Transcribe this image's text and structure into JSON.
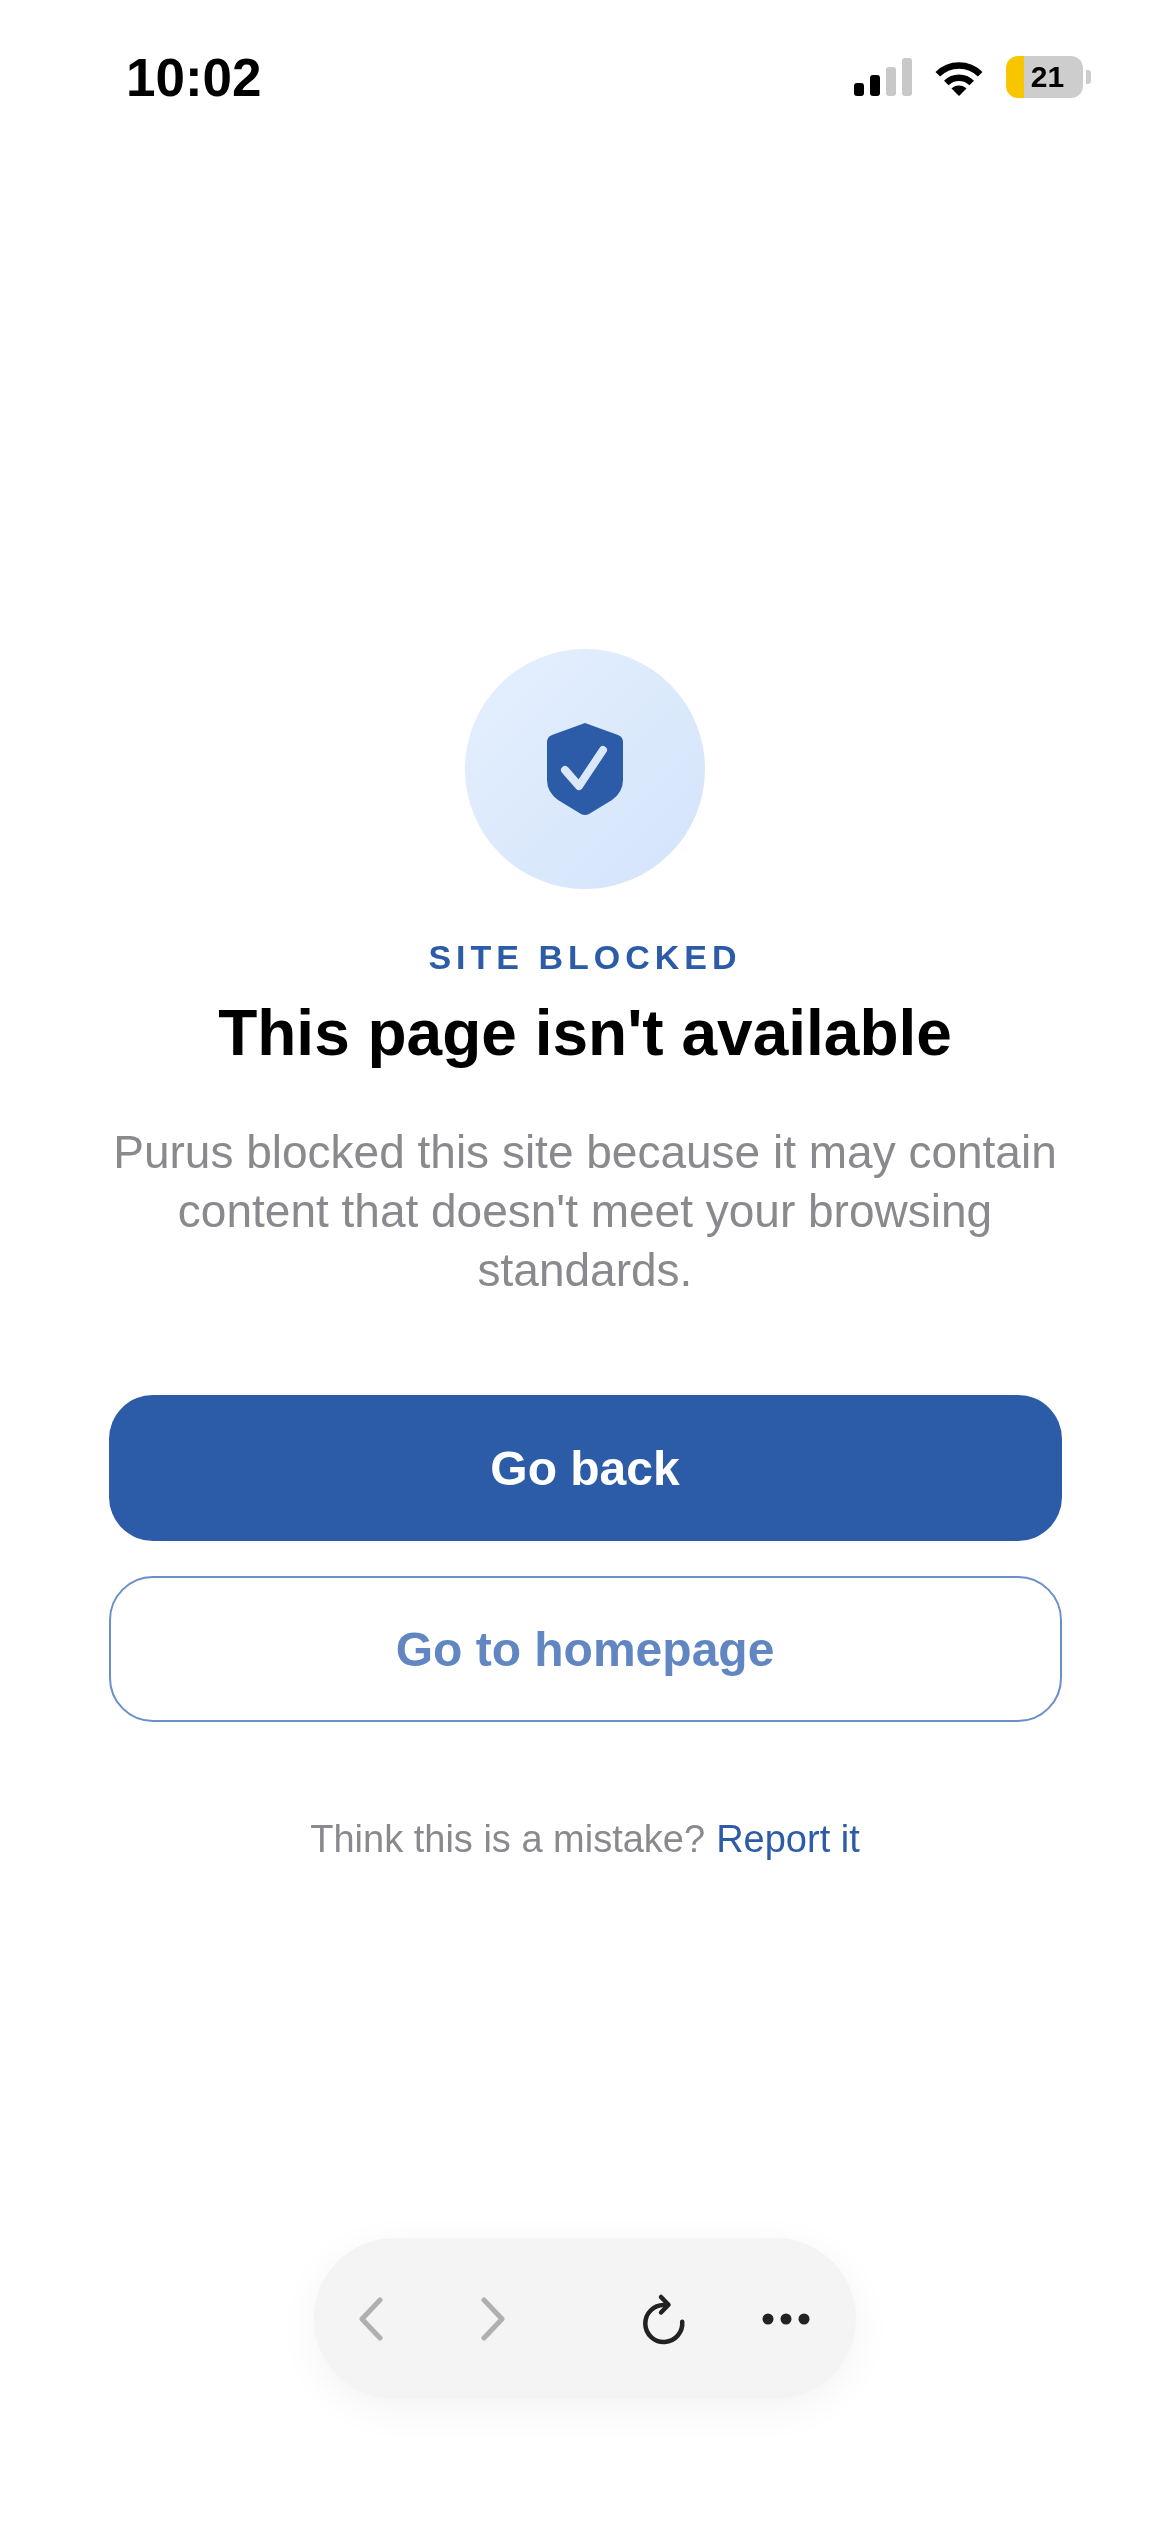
{
  "status_bar": {
    "time": "10:02",
    "battery": "21"
  },
  "notice": {
    "eyebrow": "SITE BLOCKED",
    "title": "This page isn't available",
    "message": "Purus blocked this site because it may contain content that doesn't meet your browsing standards."
  },
  "actions": [
    {
      "label": "Go back",
      "kind": "primary"
    },
    {
      "label": "Go to homepage",
      "kind": "secondary"
    }
  ],
  "report": {
    "prompt": "Think this is a mistake?",
    "link": "Report it"
  },
  "toolbar": [
    {
      "buttons": [
        {
          "kind": "back",
          "disabled": true
        },
        {
          "kind": "forward",
          "disabled": true
        }
      ]
    },
    {
      "buttons": [
        {
          "kind": "reload",
          "disabled": false
        },
        {
          "kind": "more",
          "disabled": false
        }
      ]
    }
  ]
}
